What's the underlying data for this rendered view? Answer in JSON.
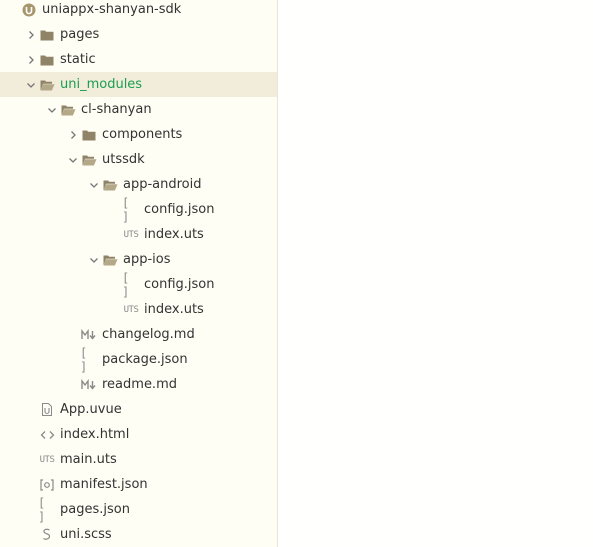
{
  "explorer": {
    "nodes": [
      {
        "label": "uniappx-shanyan-sdk",
        "icon": "uniapp-logo-icon",
        "expander": "none"
      },
      {
        "label": "pages",
        "icon": "folder-icon",
        "expander": "collapsed"
      },
      {
        "label": "static",
        "icon": "folder-icon",
        "expander": "collapsed"
      },
      {
        "label": "uni_modules",
        "icon": "folder-open-icon",
        "expander": "expanded",
        "selected": true
      },
      {
        "label": "cl-shanyan",
        "icon": "folder-open-icon",
        "expander": "expanded"
      },
      {
        "label": "components",
        "icon": "folder-icon",
        "expander": "collapsed"
      },
      {
        "label": "utssdk",
        "icon": "folder-open-icon",
        "expander": "expanded"
      },
      {
        "label": "app-android",
        "icon": "folder-open-icon",
        "expander": "expanded"
      },
      {
        "label": "config.json",
        "icon": "json-file-icon",
        "expander": "none"
      },
      {
        "label": "index.uts",
        "icon": "uts-file-icon",
        "expander": "none"
      },
      {
        "label": "app-ios",
        "icon": "folder-open-icon",
        "expander": "expanded"
      },
      {
        "label": "config.json",
        "icon": "json-file-icon",
        "expander": "none"
      },
      {
        "label": "index.uts",
        "icon": "uts-file-icon",
        "expander": "none"
      },
      {
        "label": "changelog.md",
        "icon": "markdown-file-icon",
        "expander": "none"
      },
      {
        "label": "package.json",
        "icon": "json-file-icon",
        "expander": "none"
      },
      {
        "label": "readme.md",
        "icon": "markdown-file-icon",
        "expander": "none"
      },
      {
        "label": "App.uvue",
        "icon": "uvue-file-icon",
        "expander": "none"
      },
      {
        "label": "index.html",
        "icon": "html-file-icon",
        "expander": "none"
      },
      {
        "label": "main.uts",
        "icon": "uts-file-icon",
        "expander": "none"
      },
      {
        "label": "manifest.json",
        "icon": "manifest-file-icon",
        "expander": "none"
      },
      {
        "label": "pages.json",
        "icon": "json-file-icon",
        "expander": "none"
      },
      {
        "label": "uni.scss",
        "icon": "scss-file-icon",
        "expander": "none"
      }
    ],
    "icon_text": {
      "uts": "UTS",
      "json": "[ ]",
      "md_m": "M",
      "manifest": "[o]"
    }
  },
  "colors": {
    "folder": "#8f8368",
    "selected_bg": "#f2ecdb",
    "selected_text": "#1a9e4e",
    "icon_gray": "#8a8a8a",
    "logo": "#a8966c"
  }
}
